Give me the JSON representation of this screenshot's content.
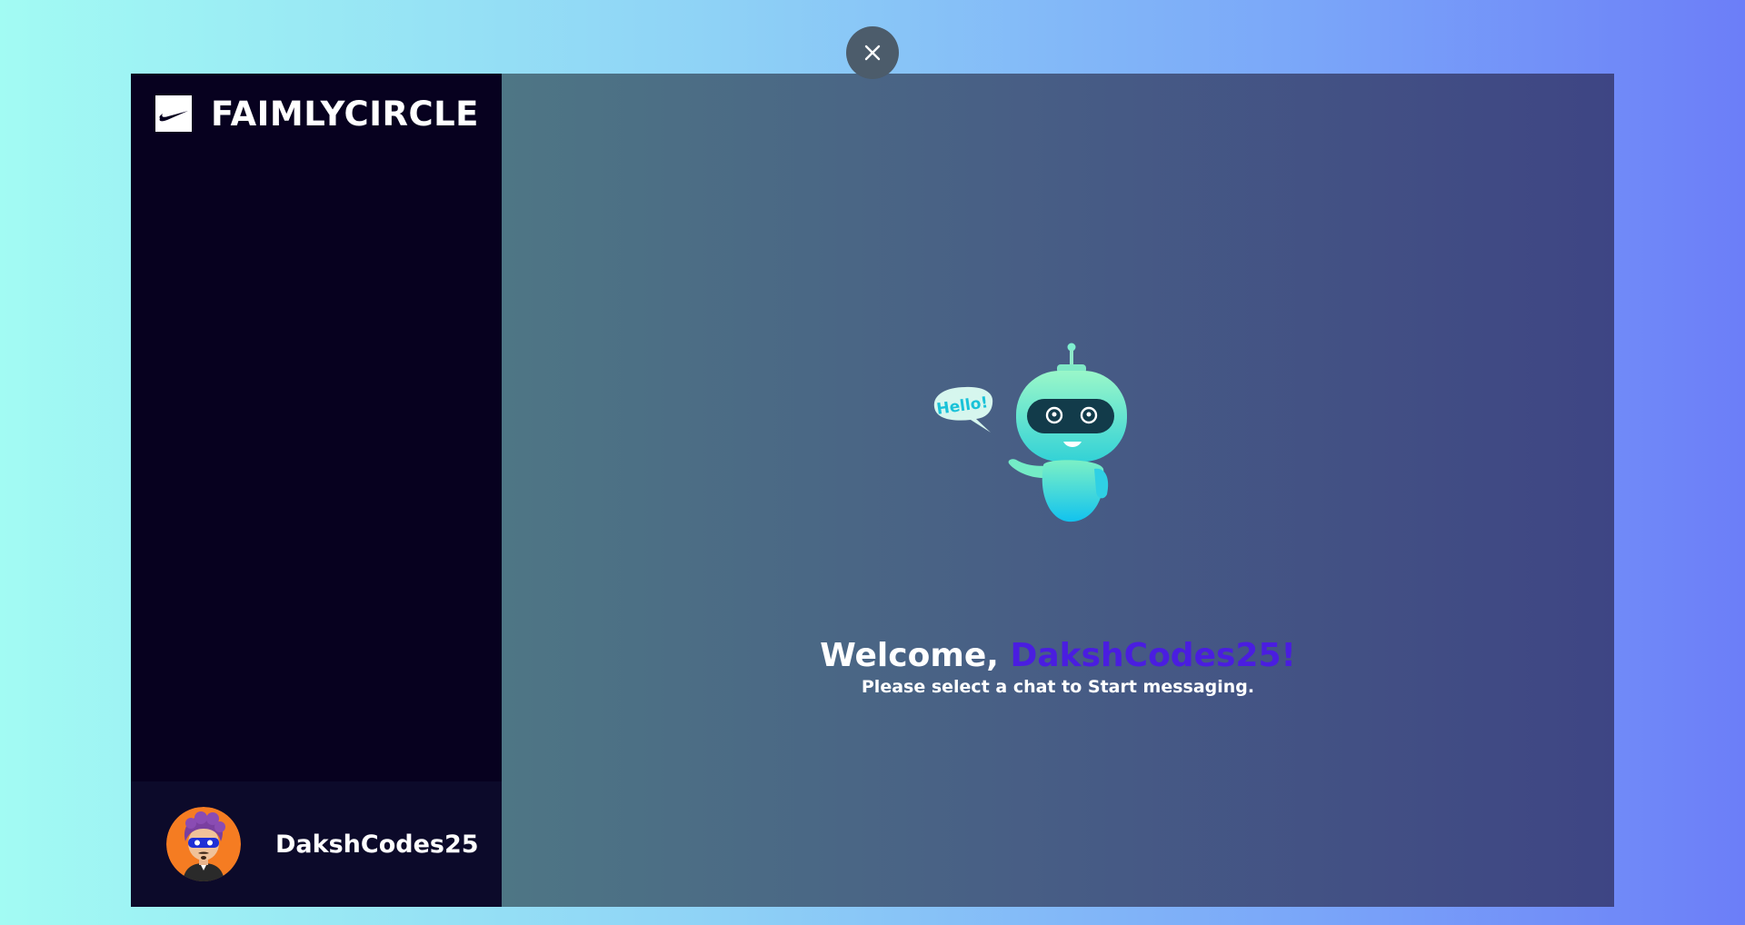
{
  "brand": {
    "name": "FAIMLYCIRCLE",
    "logo_icon": "swoosh-logo-icon"
  },
  "close_icon": "close-icon",
  "user": {
    "name": "DakshCodes25",
    "avatar_icon": "avatar-icon"
  },
  "welcome": {
    "greeting": "Welcome,",
    "name": "DakshCodes25!",
    "subtitle": "Please select a chat to Start messaging.",
    "illustration_text": "Hello!"
  },
  "colors": {
    "sidebar_bg": "#07011f",
    "user_bar_bg": "#0c0a2a",
    "accent_name": "#4a1de0",
    "avatar_bg": "#f57c22"
  }
}
